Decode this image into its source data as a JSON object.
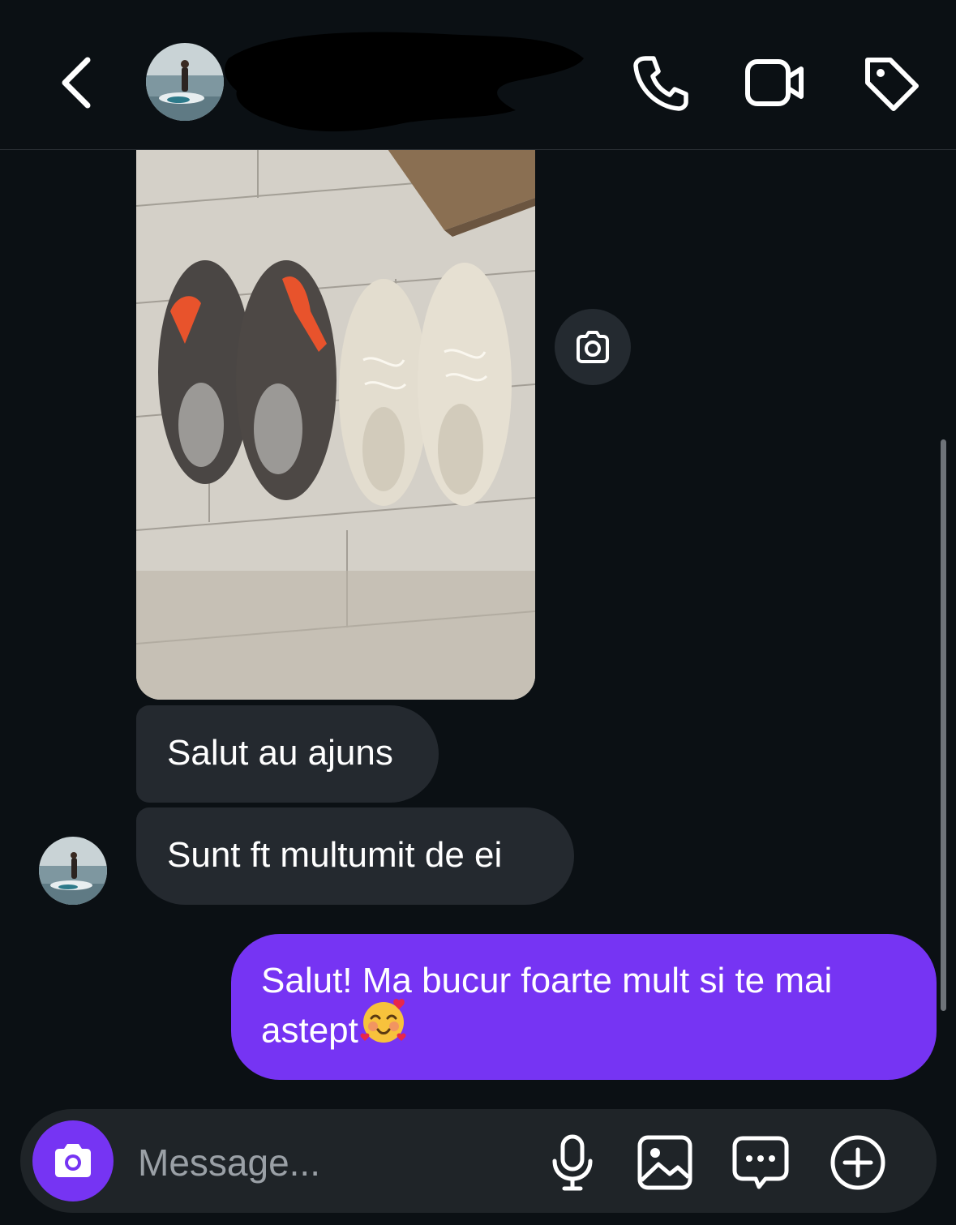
{
  "header": {
    "contact_name": "",
    "contact_username": "",
    "icons": [
      "chevron-left-icon",
      "phone-icon",
      "video-camera-icon",
      "tag-icon"
    ]
  },
  "thread": {
    "photo": {
      "subject": "sneakers-photo"
    },
    "incoming": [
      {
        "text": "Salut au ajuns"
      },
      {
        "text": "Sunt ft multumit de ei"
      }
    ],
    "outgoing": [
      {
        "text": "Salut! Ma bucur foarte mult si te mai astept",
        "emoji": "🥰"
      }
    ]
  },
  "composer": {
    "placeholder": "Message...",
    "value": ""
  },
  "colors": {
    "background": "#0b1014",
    "incoming_bubble": "#24292f",
    "outgoing_bubble": "#7634f3",
    "composer": "#1f2428"
  }
}
